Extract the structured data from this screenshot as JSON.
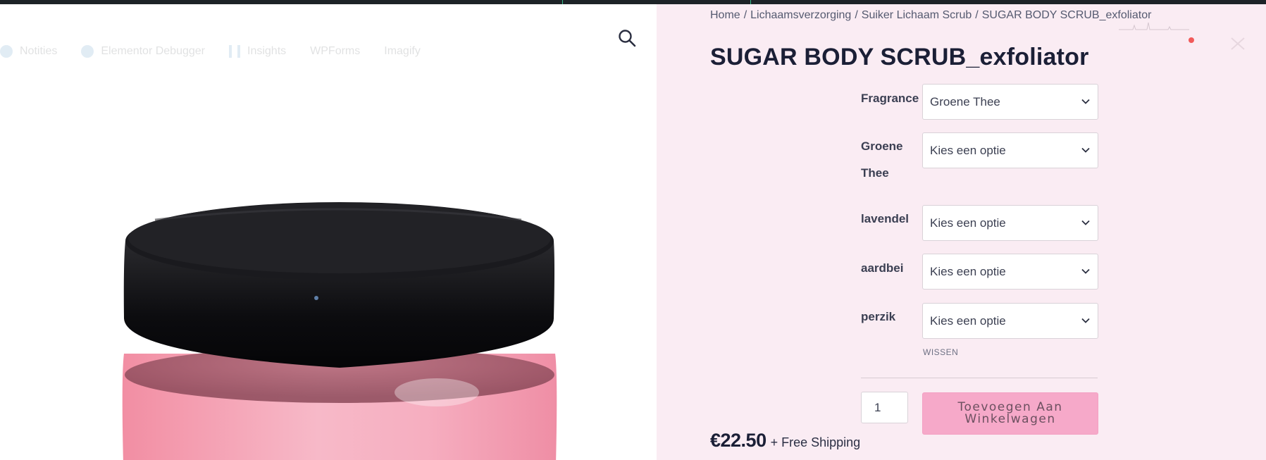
{
  "admin_bar": {
    "items": [
      "Notities",
      "Elementor Debugger",
      "Insights",
      "WPForms",
      "Imagify"
    ]
  },
  "breadcrumb": {
    "items": [
      "Home",
      "Lichaamsverzorging",
      "Suiker Lichaam Scrub",
      "SUGAR BODY SCRUB_exfoliator"
    ],
    "separator": "/"
  },
  "product": {
    "title": "SUGAR BODY SCRUB_exfoliator",
    "price": "€22.50",
    "shipping": "+ Free Shipping"
  },
  "variations": [
    {
      "label": "Fragrance",
      "value": "Groene Thee"
    },
    {
      "label": "Groene Thee",
      "value": "Kies een optie"
    },
    {
      "label": "lavendel",
      "value": "Kies een optie"
    },
    {
      "label": "aardbei",
      "value": "Kies een optie"
    },
    {
      "label": "perzik",
      "value": "Kies een optie"
    }
  ],
  "reset_label": "WISSEN",
  "cart": {
    "quantity": "1",
    "add_button": "Toevoegen Aan Winkelwagen"
  },
  "colors": {
    "right_pane_bg": "#faecf3",
    "button_bg": "#f6a9c9",
    "title_color": "#1b1f36",
    "topbar": "#1d2327"
  },
  "icons": {
    "search": "search-icon",
    "chevron": "chevron-down-icon",
    "notification": "notification-dot-icon"
  }
}
